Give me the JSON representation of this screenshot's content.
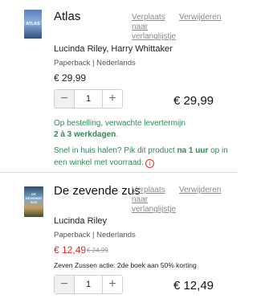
{
  "items": [
    {
      "cover_text": "ATLAS",
      "title": "Atlas",
      "move_link": "Verplaats naar verlanglijstje",
      "remove_link": "Verwijderen",
      "authors": "Lucinda Riley, Harry Whittaker",
      "format": "Paperback | Nederlands",
      "price": "€ 29,99",
      "quantity": "1",
      "line_total": "€ 29,99",
      "delivery_line1": "Op bestelling, verwachte levertermijn",
      "delivery_strong": "2 à 3 werkdagen",
      "delivery_end": ".",
      "pickup_prefix": "Snel in huis halen? Pik dit product ",
      "pickup_strong": "na 1 uur",
      "pickup_suffix": " op in een winkel met voorraad.",
      "info_icon": "i"
    },
    {
      "cover_text": "DE ZEVENDE ZUS",
      "title": "De zevende zus",
      "move_link": "Verplaats naar verlanglijstje",
      "remove_link": "Verwijderen",
      "authors": "Lucinda Riley",
      "format": "Paperback | Nederlands",
      "sale_price": "€ 12,49",
      "old_price": "€ 24,99",
      "promo": "Zeven Zussen actie: 2de boek aan 50% korting",
      "quantity": "1",
      "line_total": "€ 12,49"
    }
  ],
  "qty_controls": {
    "minus": "−",
    "plus": "+"
  },
  "colors": {
    "stock_green": "#2e8b57",
    "sale_red": "#d0352d",
    "link_grey": "#8a8a8a"
  }
}
